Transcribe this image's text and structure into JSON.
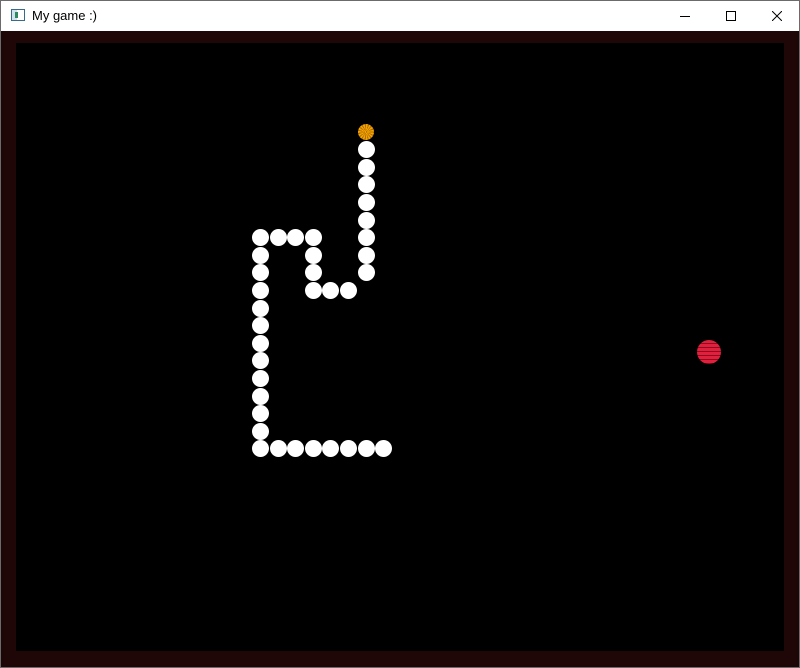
{
  "window": {
    "title": "My game :)",
    "controls": {
      "minimize_icon": "minimize-icon",
      "maximize_icon": "maximize-icon",
      "close_icon": "close-icon"
    }
  },
  "game": {
    "background_color": "#000000",
    "border_color": "#200707",
    "snake": {
      "body_color": "#ffffff",
      "head_color": "#f0a800",
      "head_cell": [
        0,
        0
      ],
      "segments_cells": [
        [
          0,
          1
        ],
        [
          0,
          2
        ],
        [
          0,
          3
        ],
        [
          0,
          4
        ],
        [
          0,
          5
        ],
        [
          0,
          6
        ],
        [
          0,
          7
        ],
        [
          0,
          8
        ],
        [
          -1,
          9
        ],
        [
          -2,
          9
        ],
        [
          -3,
          9
        ],
        [
          -3,
          8
        ],
        [
          -3,
          7
        ],
        [
          -3,
          6
        ],
        [
          -4,
          6
        ],
        [
          -5,
          6
        ],
        [
          -6,
          6
        ],
        [
          -6,
          7
        ],
        [
          -6,
          8
        ],
        [
          -6,
          9
        ],
        [
          -6,
          10
        ],
        [
          -6,
          11
        ],
        [
          -6,
          12
        ],
        [
          -6,
          13
        ],
        [
          -6,
          14
        ],
        [
          -6,
          15
        ],
        [
          -6,
          16
        ],
        [
          -6,
          17
        ],
        [
          -6,
          18
        ],
        [
          -5,
          18
        ],
        [
          -4,
          18
        ],
        [
          -3,
          18
        ],
        [
          -2,
          18
        ],
        [
          -1,
          18
        ],
        [
          0,
          18
        ],
        [
          1,
          18
        ]
      ]
    },
    "food": {
      "color": "#e0203c",
      "cell": [
        19.5,
        12.5
      ]
    }
  }
}
